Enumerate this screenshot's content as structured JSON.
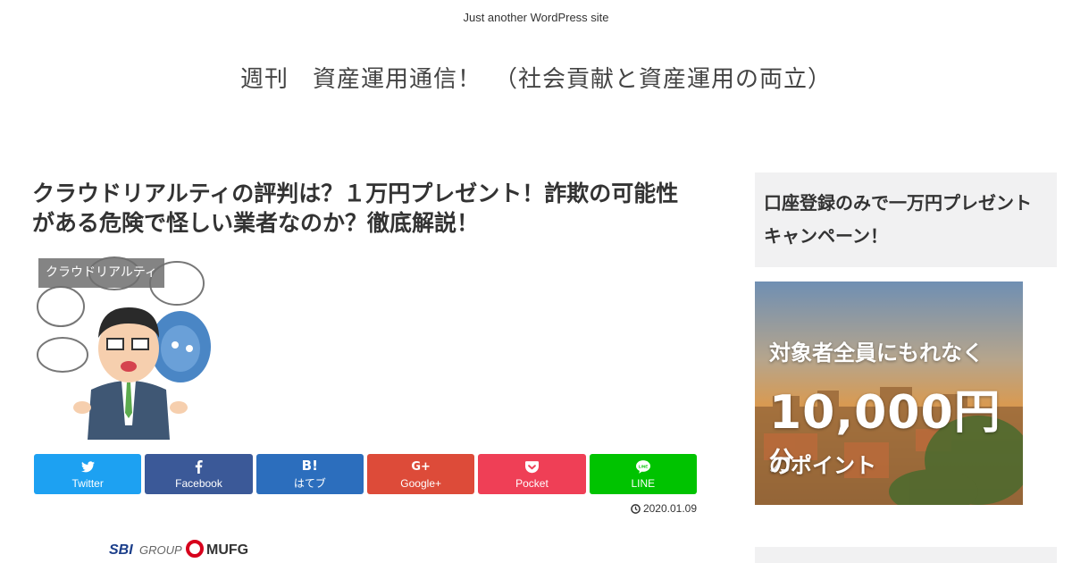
{
  "header": {
    "tagline": "Just another WordPress site",
    "site_title": "週刊　資産運用通信！　（社会貢献と資産運用の両立）"
  },
  "post": {
    "title": "クラウドリアルティの評判は？１万円プレゼント！詐欺の可能性がある危険で怪しい業者なのか？徹底解説！",
    "category": "クラウドリアルティ",
    "date": "2020.01.09"
  },
  "share": [
    {
      "label": "Twitter",
      "icon": "twitter-icon",
      "color": "#1da1f2"
    },
    {
      "label": "Facebook",
      "icon": "facebook-icon",
      "color": "#3b5998"
    },
    {
      "label": "はてブ",
      "icon": "hatena-icon",
      "color": "#2c6ebd"
    },
    {
      "label": "Google+",
      "icon": "googleplus-icon",
      "color": "#dd4b39"
    },
    {
      "label": "Pocket",
      "icon": "pocket-icon",
      "color": "#ef3f56"
    },
    {
      "label": "LINE",
      "icon": "line-icon",
      "color": "#00c300"
    }
  ],
  "logos": {
    "sbi": "SBI",
    "group": "GROUP",
    "mufg": "MUFG"
  },
  "sidebar": {
    "widget_title": "口座登録のみで一万円プレゼントキャンペーン！",
    "banner": {
      "line1": "対象者全員にもれなく",
      "amount": "10,000円",
      "suffix": "分",
      "line3": "のポイント"
    }
  },
  "colors": {
    "widget_bg": "#f1f1f2",
    "category_bg": "#6e6e6e"
  }
}
